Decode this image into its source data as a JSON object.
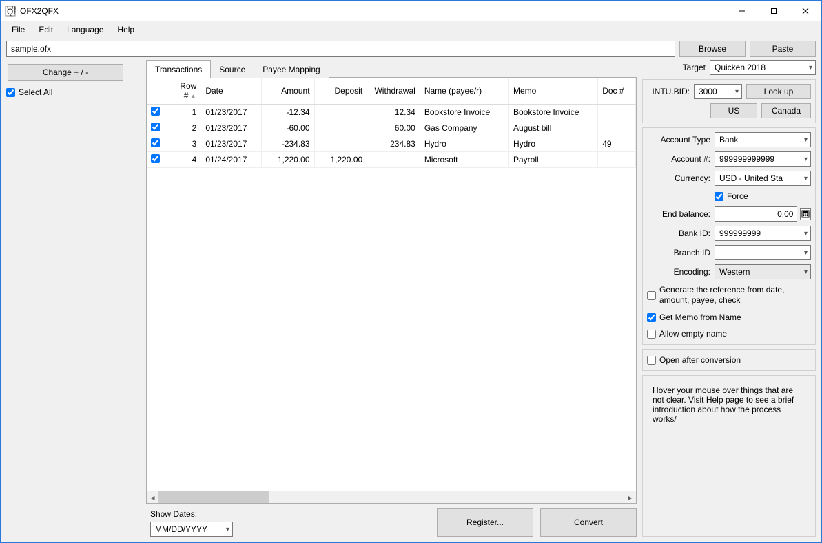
{
  "window": {
    "title": "OFX2QFX"
  },
  "menu": {
    "file": "File",
    "edit": "Edit",
    "language": "Language",
    "help": "Help"
  },
  "filebar": {
    "path": "sample.ofx",
    "browse": "Browse",
    "paste": "Paste"
  },
  "left": {
    "change": "Change + / -",
    "select_all": "Select All"
  },
  "tabs": {
    "transactions": "Transactions",
    "source": "Source",
    "payee_mapping": "Payee Mapping"
  },
  "table": {
    "headers": {
      "row": "Row #",
      "date": "Date",
      "amount": "Amount",
      "deposit": "Deposit",
      "withdrawal": "Withdrawal",
      "name": "Name (payee/r)",
      "memo": "Memo",
      "doc": "Doc #"
    },
    "rows": [
      {
        "n": "1",
        "date": "01/23/2017",
        "amount": "-12.34",
        "deposit": "",
        "withdrawal": "12.34",
        "name": "Bookstore Invoice",
        "memo": "Bookstore Invoice",
        "doc": ""
      },
      {
        "n": "2",
        "date": "01/23/2017",
        "amount": "-60.00",
        "deposit": "",
        "withdrawal": "60.00",
        "name": "Gas Company",
        "memo": "August bill",
        "doc": ""
      },
      {
        "n": "3",
        "date": "01/23/2017",
        "amount": "-234.83",
        "deposit": "",
        "withdrawal": "234.83",
        "name": "Hydro",
        "memo": "Hydro",
        "doc": "49"
      },
      {
        "n": "4",
        "date": "01/24/2017",
        "amount": "1,220.00",
        "deposit": "1,220.00",
        "withdrawal": "",
        "name": "Microsoft",
        "memo": "Payroll",
        "doc": ""
      }
    ]
  },
  "showdates": {
    "label": "Show Dates:",
    "value": "MM/DD/YYYY"
  },
  "actions": {
    "register": "Register...",
    "convert": "Convert"
  },
  "right": {
    "target_label": "Target",
    "target_value": "Quicken 2018",
    "intu_label": "INTU.BID:",
    "intu_value": "3000",
    "lookup": "Look up",
    "us": "US",
    "canada": "Canada",
    "account_type_label": "Account Type",
    "account_type_value": "Bank",
    "account_num_label": "Account #:",
    "account_num_value": "999999999999",
    "currency_label": "Currency:",
    "currency_value": "USD - United Sta",
    "force": "Force",
    "end_balance_label": "End balance:",
    "end_balance_value": "0.00",
    "bank_id_label": "Bank ID:",
    "bank_id_value": "999999999",
    "branch_id_label": "Branch ID",
    "branch_id_value": "",
    "encoding_label": "Encoding:",
    "encoding_value": "Western",
    "gen_ref": "Generate the reference from date, amount, payee, check",
    "get_memo": "Get Memo from Name",
    "allow_empty": "Allow empty name",
    "open_after": "Open after conversion",
    "hint": "Hover your mouse over things that are not clear. Visit Help page to see a brief introduction about how the process works/"
  }
}
